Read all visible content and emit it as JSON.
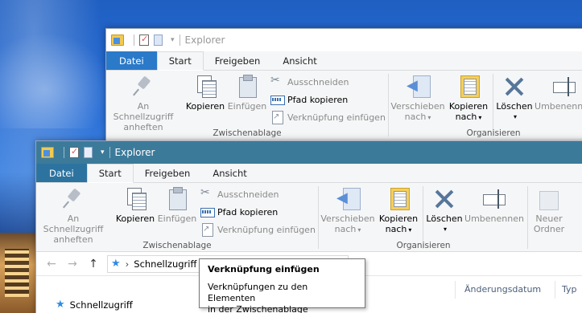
{
  "window": {
    "title": "Explorer"
  },
  "tabs": {
    "datei": "Datei",
    "start": "Start",
    "freigeben": "Freigeben",
    "ansicht": "Ansicht"
  },
  "ribbon": {
    "pin_line1": "An Schnellzugriff",
    "pin_line2": "anheften",
    "kopieren": "Kopieren",
    "einfuegen": "Einfügen",
    "ausschneiden": "Ausschneiden",
    "pfad_kopieren": "Pfad kopieren",
    "verknuepfung_einfuegen": "Verknüpfung einfügen",
    "group_clipboard": "Zwischenablage",
    "verschieben_line1": "Verschieben",
    "verschieben_line2": "nach",
    "kopieren_nach_line1": "Kopieren",
    "kopieren_nach_line2": "nach",
    "loeschen": "Löschen",
    "umbenennen": "Umbenennen",
    "group_organize": "Organisieren",
    "neuer_line1": "Neuer",
    "neuer_line2": "Ordner"
  },
  "address": {
    "location": "Schnellzugriff"
  },
  "columns": {
    "aenderungsdatum": "Änderungsdatum",
    "typ": "Typ"
  },
  "navpane": {
    "quick_access": "Schnellzugriff"
  },
  "tooltip": {
    "title": "Verknüpfung einfügen",
    "line1": "Verknüpfungen zu den Elementen",
    "line2": "in der Zwischenablage speichern."
  },
  "icons": {
    "pin": "pin-icon",
    "copy": "copy-icon",
    "paste": "paste-icon",
    "cut": "scissors-icon",
    "copy_path": "copy-path-icon",
    "paste_shortcut": "paste-shortcut-icon",
    "move_to": "move-to-icon",
    "copy_to": "copy-to-icon",
    "delete": "delete-icon",
    "rename": "rename-icon",
    "new_folder": "new-folder-icon",
    "quick_access_star": "star-icon"
  },
  "colors": {
    "file_tab_back": "#2b79c9",
    "file_tab_front": "#2d73a0",
    "titlebar_front": "#3c7a9a"
  }
}
